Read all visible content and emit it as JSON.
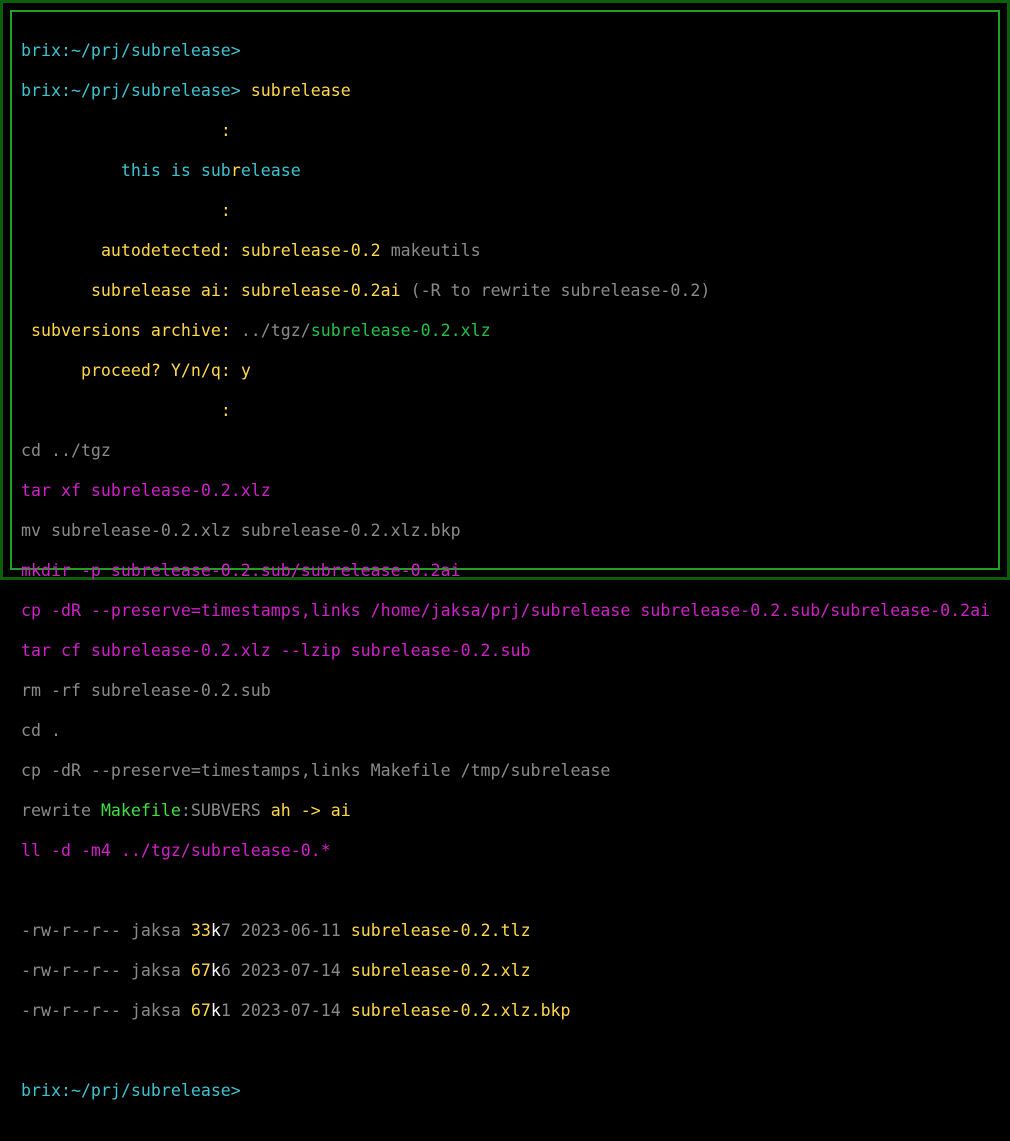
{
  "prompt": "brix:~/prj/subrelease>",
  "command": "subrelease",
  "colon": ":",
  "banner": {
    "pre": "this is sub",
    "mid": "r",
    "post": "elease"
  },
  "fields": {
    "autodetected_label": "autodetected:",
    "autodetected_value": "subrelease-0.2",
    "autodetected_extra": "makeutils",
    "ai_label": "subrelease ai:",
    "ai_value": "subrelease-0.2ai",
    "ai_note": "(-R to rewrite subrelease-0.2)",
    "archive_label": "subversions archive:",
    "archive_dir": "../tgz/",
    "archive_file": "subrelease-0.2.xlz",
    "proceed_label": "proceed? Y/n/q:",
    "proceed_answer": "y"
  },
  "log": {
    "l1": "cd ../tgz",
    "l2": "tar xf subrelease-0.2.xlz",
    "l3": "mv subrelease-0.2.xlz subrelease-0.2.xlz.bkp",
    "l4": "mkdir -p subrelease-0.2.sub/subrelease-0.2ai",
    "l5": "cp -dR --preserve=timestamps,links /home/jaksa/prj/subrelease subrelease-0.2.sub/subrelease-0.2ai",
    "l6": "tar cf subrelease-0.2.xlz --lzip subrelease-0.2.sub",
    "l7": "rm -rf subrelease-0.2.sub",
    "l8": "cd .",
    "l9": "cp -dR --preserve=timestamps,links Makefile /tmp/subrelease",
    "rewrite_pre": "rewrite ",
    "rewrite_file": "Makefile",
    "rewrite_var": ":SUBVERS ",
    "rewrite_from": "ah -> ai",
    "l11": "ll -d -m4 ../tgz/subrelease-0.*"
  },
  "listing": [
    {
      "perm": "-rw-r--r--",
      "owner": "jaksa",
      "size_num": "33",
      "size_unit": "k",
      "size_frac": "7",
      "date": "2023-06-11",
      "name": "subrelease-0.2.tlz"
    },
    {
      "perm": "-rw-r--r--",
      "owner": "jaksa",
      "size_num": "67",
      "size_unit": "k",
      "size_frac": "6",
      "date": "2023-07-14",
      "name": "subrelease-0.2.xlz"
    },
    {
      "perm": "-rw-r--r--",
      "owner": "jaksa",
      "size_num": "67",
      "size_unit": "k",
      "size_frac": "1",
      "date": "2023-07-14",
      "name": "subrelease-0.2.xlz.bkp"
    }
  ],
  "colors": {
    "prompt": "#3fc3d0",
    "label": "#ffd84a",
    "command": "#d020c8",
    "border": "#22a022"
  }
}
